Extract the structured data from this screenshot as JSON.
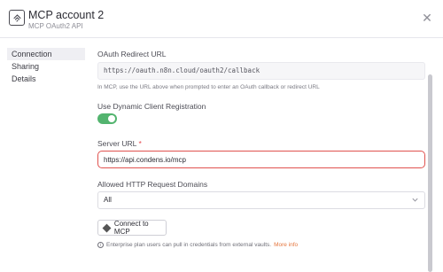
{
  "header": {
    "title": "MCP account 2",
    "subtitle": "MCP OAuth2 API",
    "app_icon": "n8n-credential-icon",
    "close_icon": "close-icon"
  },
  "sidebar": {
    "items": [
      {
        "label": "Connection",
        "active": true
      },
      {
        "label": "Sharing",
        "active": false
      },
      {
        "label": "Details",
        "active": false
      }
    ]
  },
  "form": {
    "oauth_redirect": {
      "label": "OAuth Redirect URL",
      "value": "https://oauth.n8n.cloud/oauth2/callback",
      "hint": "In MCP, use the URL above when prompted to enter an OAuth callback or redirect URL"
    },
    "dynamic_registration": {
      "label": "Use Dynamic Client Registration",
      "enabled": true
    },
    "server_url": {
      "label": "Server URL",
      "required_mark": "*",
      "value": "https://api.condens.io/mcp"
    },
    "allowed_domains": {
      "label": "Allowed HTTP Request Domains",
      "selected": "All"
    },
    "connect_button": {
      "label": "Connect to MCP"
    },
    "info": {
      "text": "Enterprise plan users can pull in credentials from external vaults.",
      "link": "More info"
    }
  },
  "colors": {
    "accent_toggle": "#53b46f",
    "error_border": "#e0524f",
    "link": "#e5773f"
  }
}
